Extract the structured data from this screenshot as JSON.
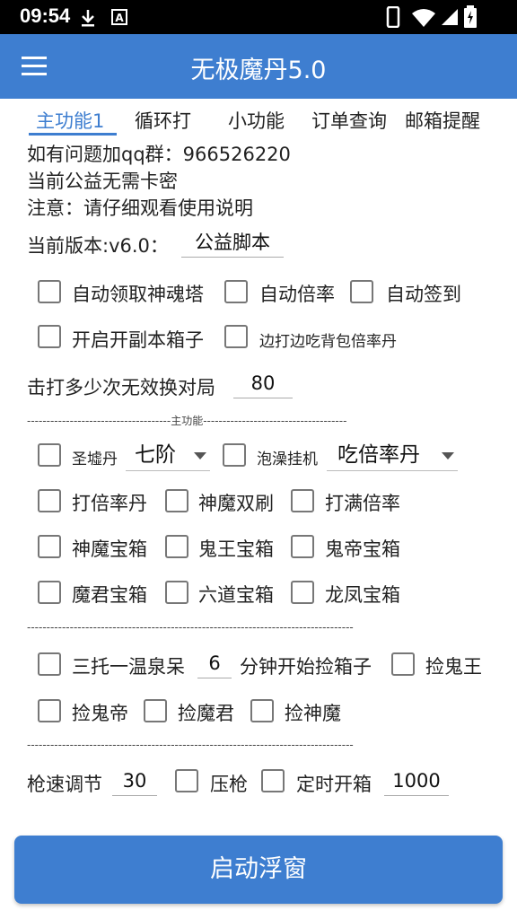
{
  "status": {
    "time": "09:54"
  },
  "app": {
    "title": "无极魔丹5.0"
  },
  "tabs": [
    "主功能1",
    "循环打",
    "小功能",
    "订单查询",
    "邮箱提醒"
  ],
  "info": {
    "line1": "如有问题加qq群：966526220",
    "line2": "当前公益无需卡密",
    "line3": "注意：请仔细观看使用说明"
  },
  "version": {
    "label": "当前版本:v6.0：",
    "value": "公益脚本"
  },
  "options_top": {
    "auto_soul_tower": "自动领取神魂塔",
    "auto_multiplier": "自动倍率",
    "auto_signin": "自动签到",
    "open_dungeon_chest": "开启开副本箱子",
    "eat_while_fight": "边打边吃背包倍率丹"
  },
  "invalid_switch": {
    "label": "击打多少次无效换对局",
    "value": "80"
  },
  "divider_main": "-------------------------------------主功能-------------------------------------",
  "divider_plain": "------------------------------------------------------------------------------------",
  "main": {
    "holy_ruins_label": "圣墟丹",
    "holy_ruins_select": "七阶",
    "bath_afk_label": "泡澡挂机",
    "bath_afk_select": "吃倍率丹",
    "hit_multiplier_pill": "打倍率丹",
    "god_demon_double": "神魔双刷",
    "hit_full_multiplier": "打满倍率",
    "god_demon_chest": "神魔宝箱",
    "ghost_king_chest": "鬼王宝箱",
    "ghost_emperor_chest": "鬼帝宝箱",
    "demon_lord_chest": "魔君宝箱",
    "six_paths_chest": "六道宝箱",
    "dragon_phoenix_chest": "龙凤宝箱"
  },
  "pickup": {
    "hot_spring_prefix": "三托一温泉呆",
    "minutes_value": "6",
    "minutes_suffix": "分钟开始捡箱子",
    "pick_ghost_king": "捡鬼王",
    "pick_ghost_emperor": "捡鬼帝",
    "pick_demon_lord": "捡魔君",
    "pick_god_demon": "捡神魔"
  },
  "bottom": {
    "gun_speed_label": "枪速调节",
    "gun_speed_value": "30",
    "recoil_label": "压枪",
    "timer_label": "定时开箱",
    "timer_value": "1000"
  },
  "start_button": "启动浮窗",
  "colors": {
    "primary": "#3e7ed0",
    "statusbar": "#000000"
  }
}
